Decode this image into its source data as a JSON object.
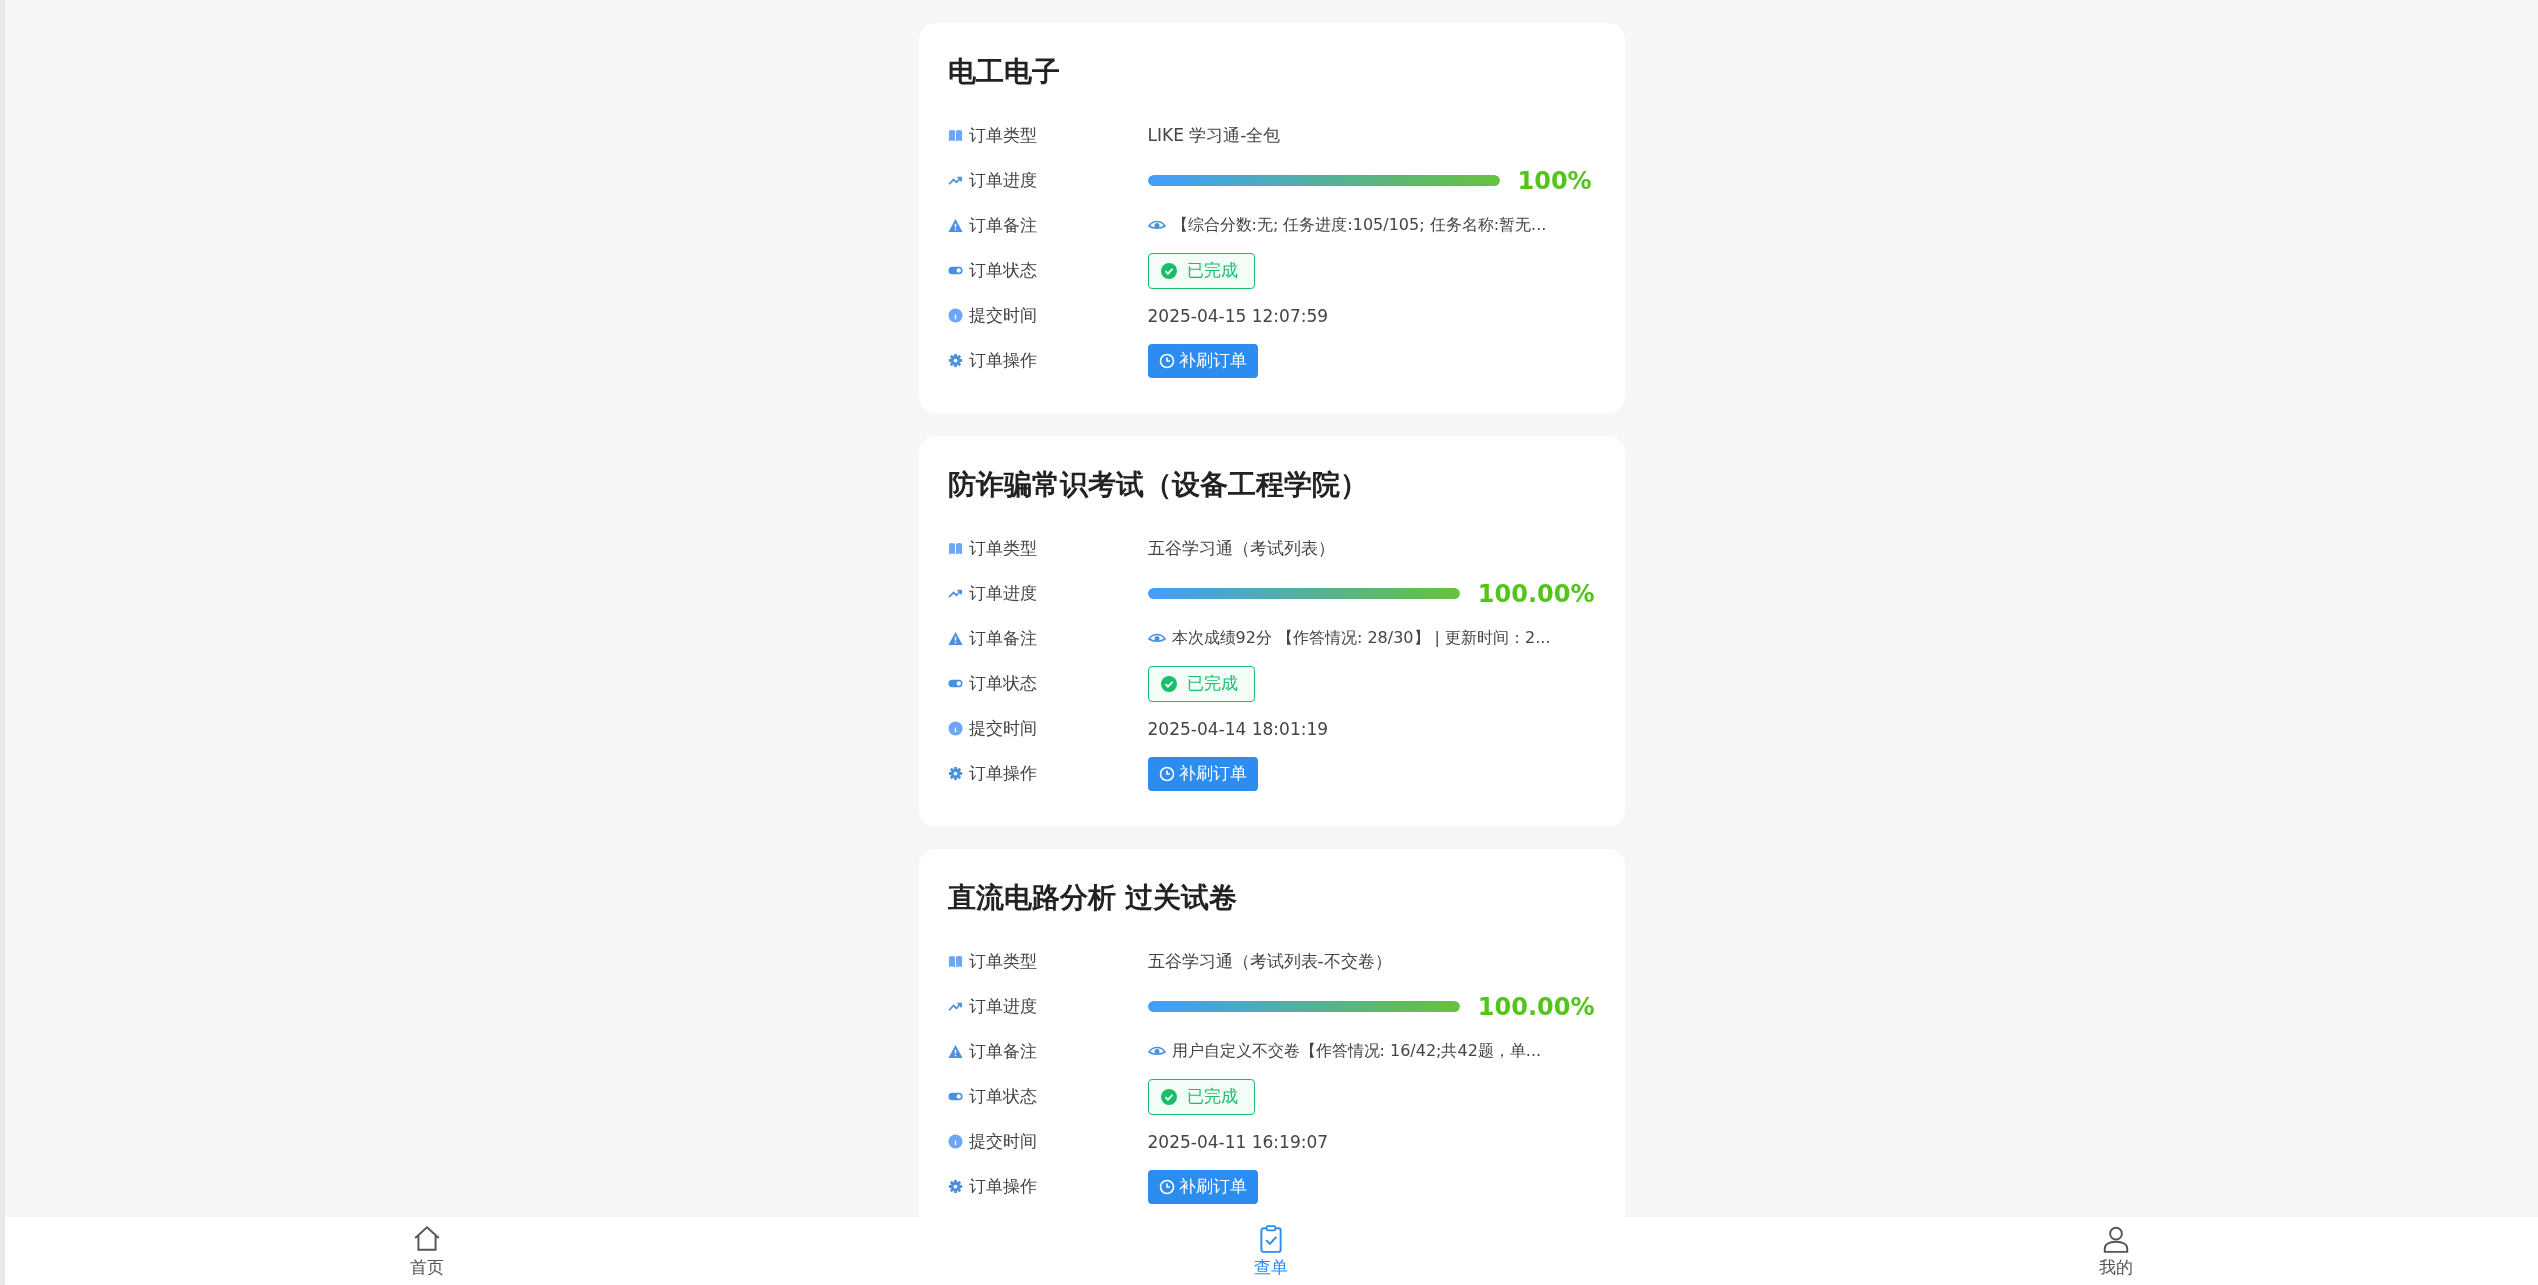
{
  "orders": [
    {
      "title": "电工电子",
      "rows": [
        {
          "kind": "text",
          "label": "订单类型",
          "value": "LIKE 学习通-全包"
        },
        {
          "kind": "progress",
          "label": "订单进度",
          "level": 1,
          "reading": "100%"
        },
        {
          "kind": "note",
          "label": "订单备注",
          "value": "【综合分数:无; 任务进度:105/105; 任务名称:暂无..."
        },
        {
          "kind": "status",
          "label": "订单状态",
          "value": "已完成",
          "completed": true
        },
        {
          "kind": "time",
          "label": "提交时间",
          "value": "2025-04-15 12:07:59"
        },
        {
          "kind": "action",
          "label": "订单操作",
          "value": "补刷订单"
        }
      ]
    },
    {
      "title": "防诈骗常识考试（设备工程学院）",
      "rows": [
        {
          "kind": "text",
          "label": "订单类型",
          "value": "五谷学习通（考试列表）"
        },
        {
          "kind": "progress",
          "label": "订单进度",
          "level": 1,
          "reading": "100.00%"
        },
        {
          "kind": "note",
          "label": "订单备注",
          "value": "本次成绩92分 【作答情况: 28/30】 | 更新时间：2..."
        },
        {
          "kind": "status",
          "label": "订单状态",
          "value": "已完成",
          "completed": true
        },
        {
          "kind": "time",
          "label": "提交时间",
          "value": "2025-04-14 18:01:19"
        },
        {
          "kind": "action",
          "label": "订单操作",
          "value": "补刷订单"
        }
      ]
    },
    {
      "title": "直流电路分析 过关试卷",
      "rows": [
        {
          "kind": "text",
          "label": "订单类型",
          "value": "五谷学习通（考试列表-不交卷）"
        },
        {
          "kind": "progress",
          "label": "订单进度",
          "level": 1,
          "reading": "100.00%"
        },
        {
          "kind": "note",
          "label": "订单备注",
          "value": "用户自定义不交卷【作答情况: 16/42;共42题，单..."
        },
        {
          "kind": "status",
          "label": "订单状态",
          "value": "已完成",
          "completed": true
        },
        {
          "kind": "time",
          "label": "提交时间",
          "value": "2025-04-11 16:19:07"
        },
        {
          "kind": "action",
          "label": "订单操作",
          "value": "补刷订单"
        }
      ]
    }
  ],
  "nav": [
    {
      "label": "首页",
      "selected": false
    },
    {
      "label": "查单",
      "selected": true
    },
    {
      "label": "我的",
      "selected": false
    }
  ]
}
